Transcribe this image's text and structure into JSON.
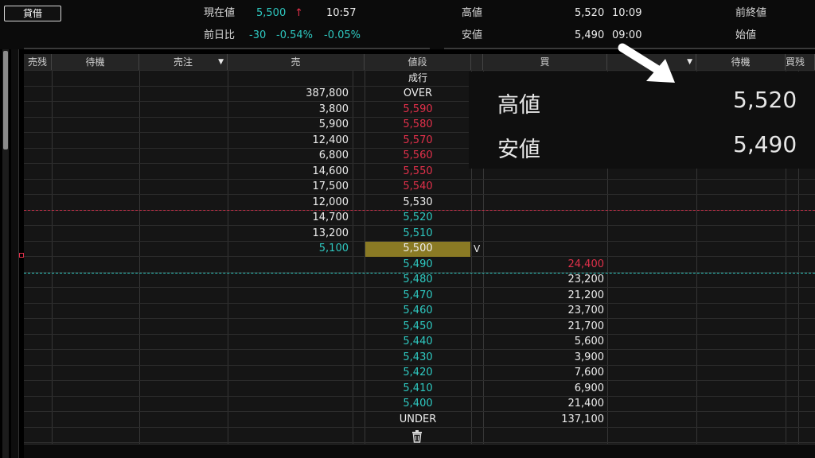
{
  "top": {
    "loan_button": "貸借",
    "current_label": "現在値",
    "current_value": "5,500",
    "current_arrow": "↑",
    "current_time": "10:57",
    "change_label": "前日比",
    "change_value": "-30",
    "change_pct": "-0.54%",
    "change_pct2": "-0.05%",
    "high_label": "高値",
    "high_value": "5,520",
    "high_time": "10:09",
    "low_label": "安値",
    "low_value": "5,490",
    "low_time": "09:00",
    "prev_close_label": "前終値",
    "open_label": "始値"
  },
  "columns": {
    "sell_remain": "売残",
    "wait_left": "待機",
    "sell_order": "売注",
    "sell": "売",
    "price": "値段",
    "buy": "買",
    "wait_right": "待機",
    "buy_remain": "買残"
  },
  "board": {
    "market_label": "成行",
    "rows": [
      {
        "sell": "387,800",
        "price": "OVER",
        "buy": "",
        "color": "white"
      },
      {
        "sell": "3,800",
        "price": "5,590",
        "buy": "",
        "color": "red"
      },
      {
        "sell": "5,900",
        "price": "5,580",
        "buy": "",
        "color": "red"
      },
      {
        "sell": "12,400",
        "price": "5,570",
        "buy": "",
        "color": "red"
      },
      {
        "sell": "6,800",
        "price": "5,560",
        "buy": "",
        "color": "red"
      },
      {
        "sell": "14,600",
        "price": "5,550",
        "buy": "",
        "color": "red"
      },
      {
        "sell": "17,500",
        "price": "5,540",
        "buy": "",
        "color": "red"
      },
      {
        "sell": "12,000",
        "price": "5,530",
        "buy": "",
        "color": "white"
      },
      {
        "sell": "14,700",
        "price": "5,520",
        "buy": "",
        "color": "cyan"
      },
      {
        "sell": "13,200",
        "price": "5,510",
        "buy": "",
        "color": "cyan"
      },
      {
        "sell": "5,100",
        "price": "5,500",
        "buy": "",
        "color": "white"
      },
      {
        "sell": "",
        "price": "5,490",
        "buy": "24,400",
        "color": "cyan"
      },
      {
        "sell": "",
        "price": "5,480",
        "buy": "23,200",
        "color": "cyan"
      },
      {
        "sell": "",
        "price": "5,470",
        "buy": "21,200",
        "color": "cyan"
      },
      {
        "sell": "",
        "price": "5,460",
        "buy": "23,700",
        "color": "cyan"
      },
      {
        "sell": "",
        "price": "5,450",
        "buy": "21,700",
        "color": "cyan"
      },
      {
        "sell": "",
        "price": "5,440",
        "buy": "5,600",
        "color": "cyan"
      },
      {
        "sell": "",
        "price": "5,430",
        "buy": "3,900",
        "color": "cyan"
      },
      {
        "sell": "",
        "price": "5,420",
        "buy": "7,600",
        "color": "cyan"
      },
      {
        "sell": "",
        "price": "5,410",
        "buy": "6,900",
        "color": "cyan"
      },
      {
        "sell": "",
        "price": "5,400",
        "buy": "21,400",
        "color": "cyan"
      },
      {
        "sell": "",
        "price": "UNDER",
        "buy": "137,100",
        "color": "white"
      }
    ],
    "vwap_mark": "V"
  },
  "popup": {
    "high_label": "高値",
    "high_value": "5,520",
    "low_label": "安値",
    "low_value": "5,490"
  },
  "colors": {
    "cyan": "#2ec8c0",
    "red": "#e0304a",
    "highlight": "#8a7a24"
  },
  "icons": [
    "trash-icon",
    "arrow-icon",
    "dropdown-triangle-icon"
  ]
}
